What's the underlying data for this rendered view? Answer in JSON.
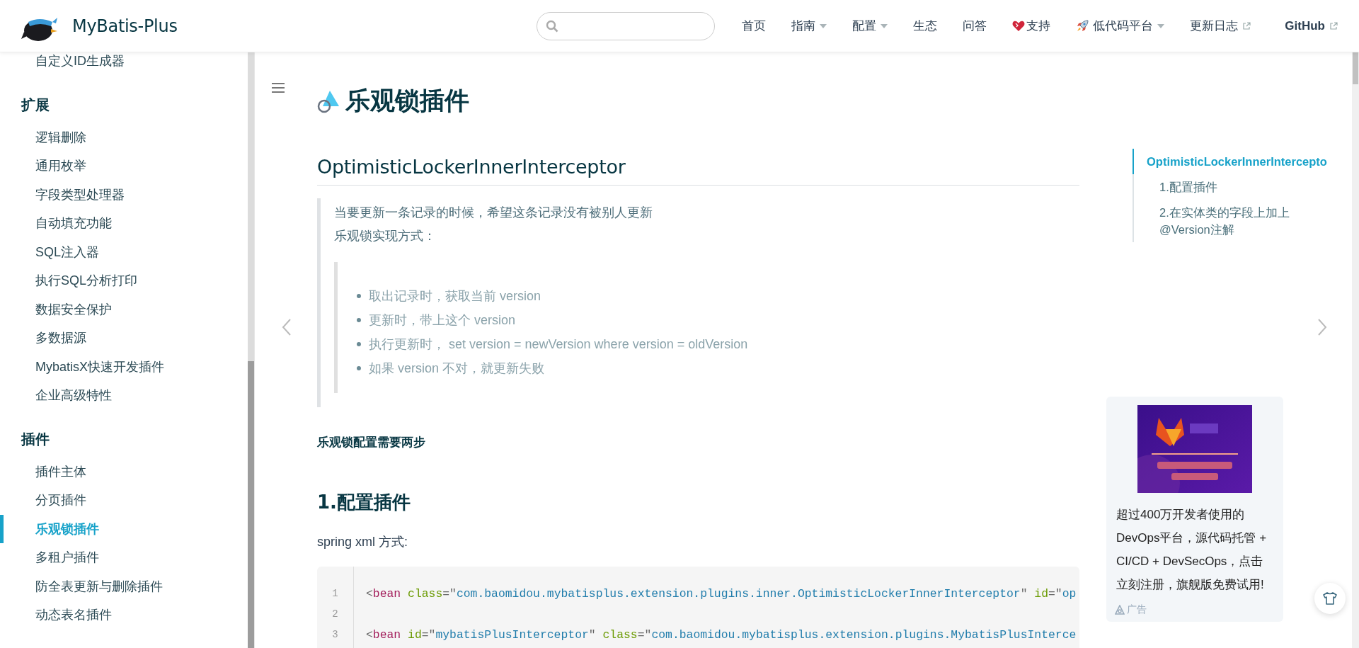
{
  "header": {
    "logo_text": "MyBatis-Plus",
    "nav": [
      {
        "label": "首页",
        "kind": "plain"
      },
      {
        "label": "指南",
        "kind": "dropdown"
      },
      {
        "label": "配置",
        "kind": "dropdown"
      },
      {
        "label": "生态",
        "kind": "plain"
      },
      {
        "label": "问答",
        "kind": "plain"
      },
      {
        "label": "支持",
        "kind": "icon"
      },
      {
        "label": "低代码平台",
        "kind": "icon-dropdown"
      },
      {
        "label": "更新日志",
        "kind": "external"
      },
      {
        "label": "GitHub",
        "kind": "external"
      }
    ]
  },
  "sidebar": {
    "sections": [
      {
        "items": [
          {
            "label": "自定义ID生成器",
            "selected": false
          }
        ]
      },
      {
        "title": "扩展",
        "items": [
          {
            "label": "逻辑删除",
            "selected": false
          },
          {
            "label": "通用枚举",
            "selected": false
          },
          {
            "label": "字段类型处理器",
            "selected": false
          },
          {
            "label": "自动填充功能",
            "selected": false
          },
          {
            "label": "SQL注入器",
            "selected": false
          },
          {
            "label": "执行SQL分析打印",
            "selected": false
          },
          {
            "label": "数据安全保护",
            "selected": false
          },
          {
            "label": "多数据源",
            "selected": false
          },
          {
            "label": "MybatisX快速开发插件",
            "selected": false
          },
          {
            "label": "企业高级特性",
            "selected": false
          }
        ]
      },
      {
        "title": "插件",
        "items": [
          {
            "label": "插件主体",
            "selected": false
          },
          {
            "label": "分页插件",
            "selected": false
          },
          {
            "label": "乐观锁插件",
            "selected": true
          },
          {
            "label": "多租户插件",
            "selected": false
          },
          {
            "label": "防全表更新与删除插件",
            "selected": false
          },
          {
            "label": "动态表名插件",
            "selected": false
          }
        ]
      }
    ]
  },
  "content": {
    "title": "乐观锁插件",
    "heading": "OptimisticLockerInnerInterceptor",
    "blockquote": {
      "lines": [
        "当要更新一条记录的时候，希望这条记录没有被别人更新",
        "乐观锁实现方式："
      ],
      "nested_list": [
        "取出记录时，获取当前 version",
        "更新时，带上这个 version",
        "执行更新时， set version = newVersion where version = oldVersion",
        "如果 version 不对，就更新失败"
      ]
    },
    "bold_paragraph": "乐观锁配置需要两步",
    "subheading": "1.配置插件",
    "paragraph": "spring xml 方式:",
    "code": {
      "lines": [
        {
          "number": "1",
          "tokens": [
            {
              "kind": "punct",
              "text": "<"
            },
            {
              "kind": "tag",
              "text": "bean"
            },
            {
              "kind": "attr",
              "text": " class"
            },
            {
              "kind": "punct",
              "text": "=\""
            },
            {
              "kind": "string",
              "text": "com.baomidou.mybatisplus.extension.plugins.inner.OptimisticLockerInnerInterceptor"
            },
            {
              "kind": "punct",
              "text": "\""
            },
            {
              "kind": "attr",
              "text": " id"
            },
            {
              "kind": "punct",
              "text": "=\""
            },
            {
              "kind": "string",
              "text": "op"
            }
          ]
        },
        {
          "number": "2"
        },
        {
          "number": "3",
          "tokens": [
            {
              "kind": "punct",
              "text": "<"
            },
            {
              "kind": "tag",
              "text": "bean"
            },
            {
              "kind": "attr",
              "text": " id"
            },
            {
              "kind": "punct",
              "text": "=\""
            },
            {
              "kind": "string",
              "text": "mybatisPlusInterceptor"
            },
            {
              "kind": "punct",
              "text": "\""
            },
            {
              "kind": "attr",
              "text": " class"
            },
            {
              "kind": "punct",
              "text": "=\""
            },
            {
              "kind": "string",
              "text": "com.baomidou.mybatisplus.extension.plugins.MybatisPlusInterce"
            }
          ]
        }
      ]
    }
  },
  "toc": {
    "items": [
      {
        "label": "OptimisticLockerInnerIntercepto",
        "selected": true,
        "children": [
          {
            "label": "1.配置插件",
            "selected": false
          },
          {
            "label": "2.在实体类的字段上加上@Version注解",
            "selected": false
          }
        ]
      }
    ]
  },
  "ad": {
    "text": "超过400万开发者使用的DevOps平台，源代码托管 + CI/CD + DevSecOps，点击立刻注册，旗舰版免费试用!",
    "label": "广告"
  }
}
